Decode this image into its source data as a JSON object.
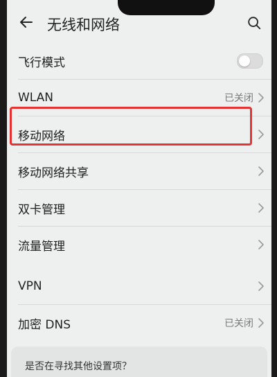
{
  "header": {
    "title": "无线和网络",
    "back_icon": "back-arrow-icon",
    "search_icon": "search-icon"
  },
  "settings": [
    {
      "label": "飞行模式",
      "value": "",
      "toggle": "off"
    },
    {
      "label": "WLAN",
      "value": "已关闭"
    },
    {
      "label": "移动网络",
      "value": ""
    },
    {
      "label": "移动网络共享",
      "value": ""
    },
    {
      "label": "双卡管理",
      "value": ""
    },
    {
      "label": "流量管理",
      "value": ""
    },
    {
      "label": "VPN",
      "value": ""
    },
    {
      "label": "加密 DNS",
      "value": "已关闭"
    }
  ],
  "suggestion": {
    "label": "是否在寻找其他设置项？"
  },
  "colors": {
    "background": "#eef0ef",
    "highlight": "#e53232",
    "text_primary": "#1f1f1f",
    "text_secondary": "#7a7a7a"
  }
}
